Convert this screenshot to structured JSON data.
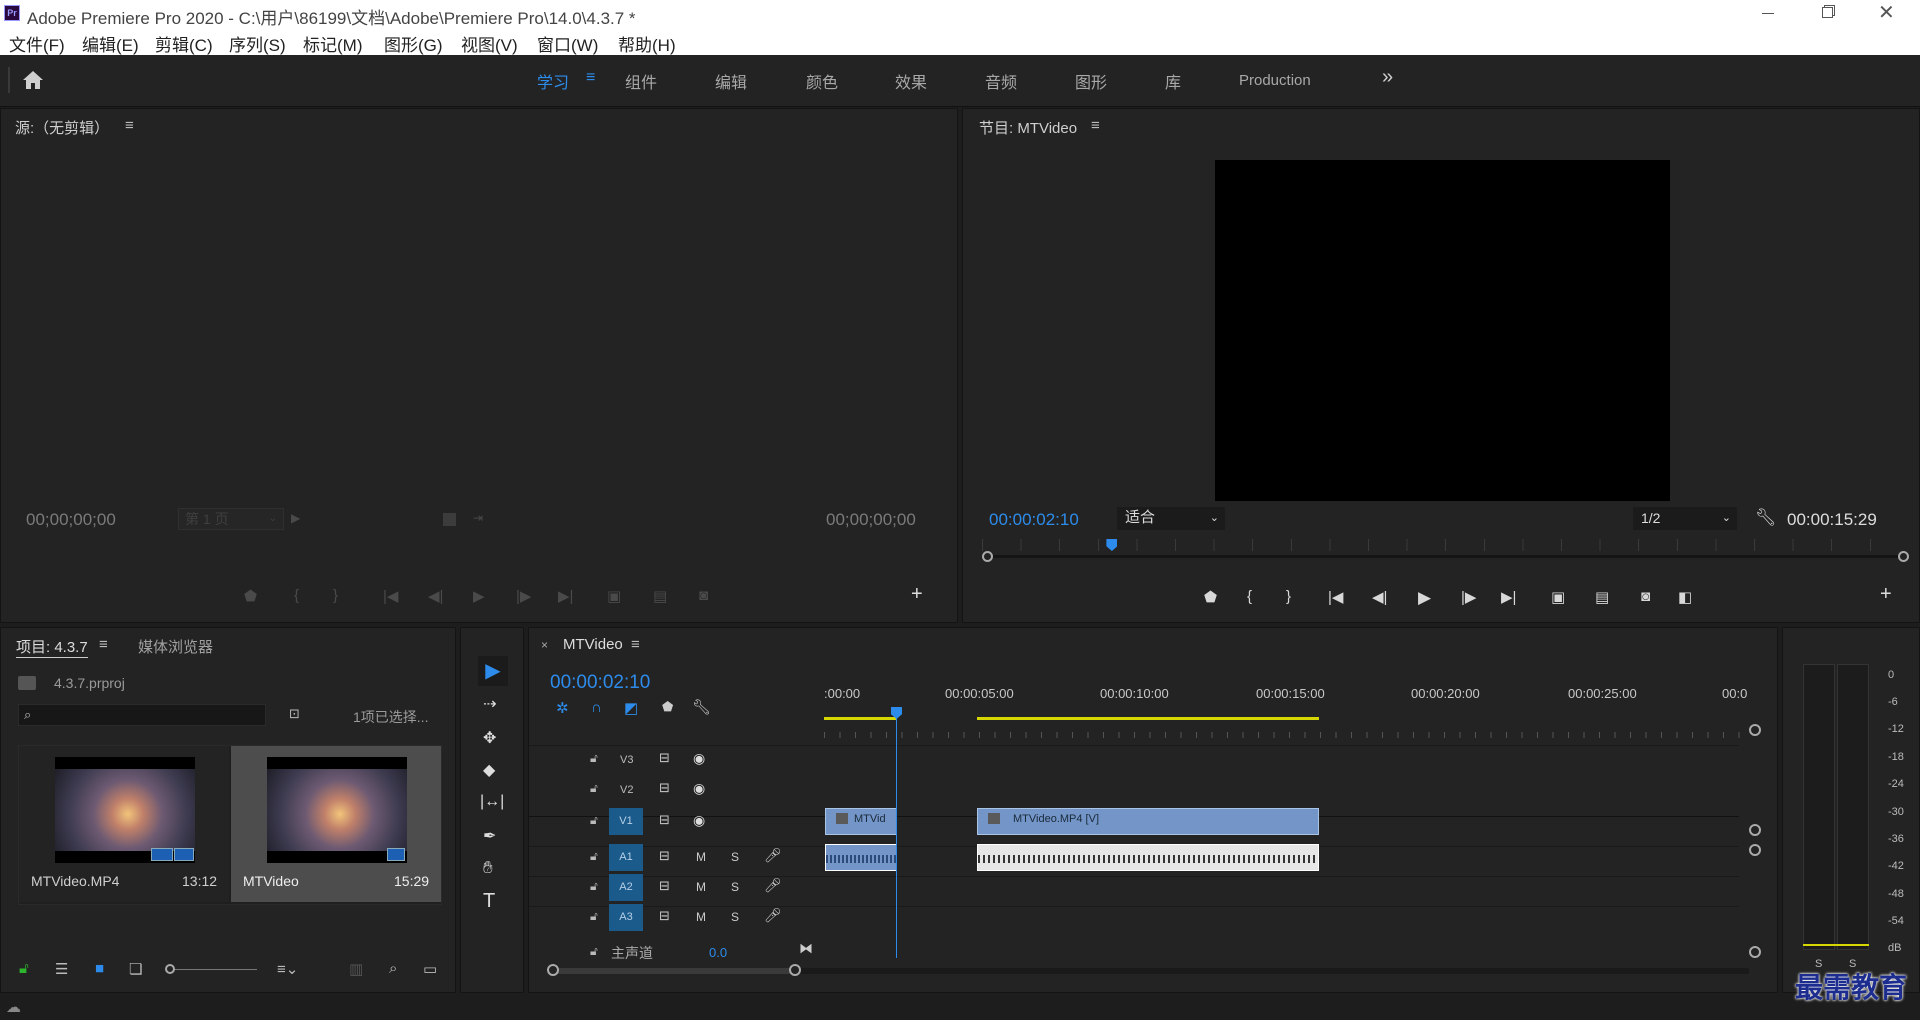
{
  "window": {
    "title": "Adobe Premiere Pro 2020 - C:\\用户\\86199\\文档\\Adobe\\Premiere Pro\\14.0\\4.3.7 *",
    "app_icon_text": "Pr"
  },
  "menu": [
    "文件(F)",
    "编辑(E)",
    "剪辑(C)",
    "序列(S)",
    "标记(M)",
    "图形(G)",
    "视图(V)",
    "窗口(W)",
    "帮助(H)"
  ],
  "workspaces": [
    "学习",
    "组件",
    "编辑",
    "颜色",
    "效果",
    "音频",
    "图形",
    "库",
    "Production"
  ],
  "workspace_active": "学习",
  "source_panel": {
    "title": "源:（无剪辑）",
    "timecode_left": "00;00;00;00",
    "timecode_right": "00;00;00;00",
    "page_select": "第 1 页"
  },
  "program_panel": {
    "title": "节目: MTVideo",
    "timecode": "00:00:02:10",
    "zoom": "适合",
    "resolution": "1/2",
    "duration": "00:00:15:29",
    "playhead_fraction": 0.135
  },
  "project_panel": {
    "tab_project": "项目: 4.3.7",
    "tab_media": "媒体浏览器",
    "file": "4.3.7.prproj",
    "selection_status": "1项已选择...",
    "items": [
      {
        "name": "MTVideo.MP4",
        "duration": "13:12"
      },
      {
        "name": "MTVideo",
        "duration": "15:29"
      }
    ]
  },
  "timeline": {
    "tab": "MTVideo",
    "timecode": "00:00:02:10",
    "ruler": [
      ":00:00",
      "00:00:05:00",
      "00:00:10:00",
      "00:00:15:00",
      "00:00:20:00",
      "00:00:25:00",
      "00:0"
    ],
    "video_tracks": [
      "V3",
      "V2",
      "V1"
    ],
    "audio_tracks": [
      "A1",
      "A2",
      "A3"
    ],
    "track_M": "M",
    "track_S": "S",
    "master_label": "主声道",
    "master_value": "0.0",
    "clips": {
      "v1_a": "MTVid",
      "v1_b": "MTVideo.MP4 [V]"
    }
  },
  "audio_meter": {
    "scale": [
      "0",
      "-6",
      "-12",
      "-18",
      "-24",
      "-30",
      "-36",
      "-42",
      "-48",
      "-54",
      "dB"
    ],
    "solo": [
      "S",
      "S"
    ]
  },
  "watermark": "最需教育",
  "colors": {
    "accent": "#2d8ceb",
    "track_blue": "#1a5b8c",
    "work_area": "#d6d600"
  }
}
